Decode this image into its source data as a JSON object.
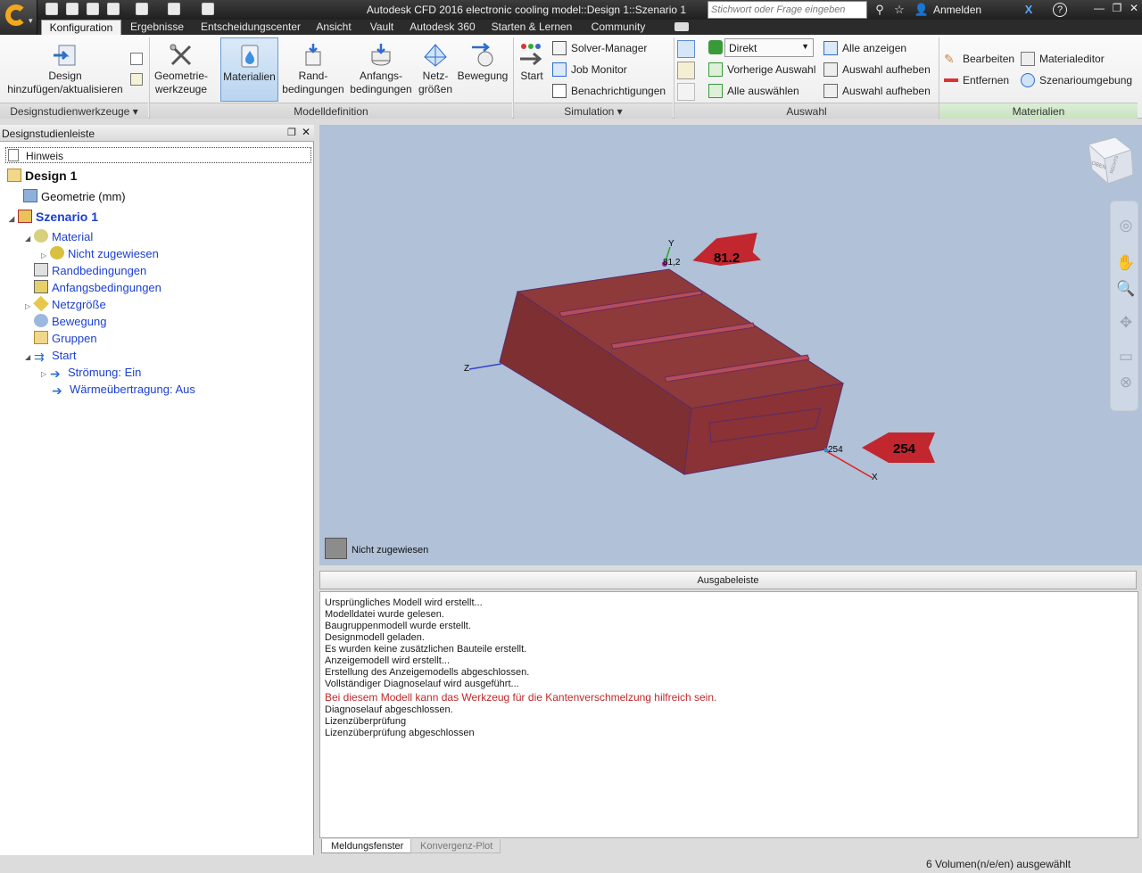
{
  "window": {
    "title": "Autodesk CFD 2016   electronic cooling model::Design 1::Szenario 1",
    "search_placeholder": "Stichwort oder Frage eingeben",
    "signin": "Anmelden",
    "help": "?"
  },
  "tabs": [
    "Konfiguration",
    "Ergebnisse",
    "Entscheidungscenter",
    "Ansicht",
    "Vault",
    "Autodesk 360",
    "Starten & Lernen",
    "Community"
  ],
  "ribbon": {
    "design_add": "Design\nhinzufügen/aktualisieren",
    "panel_designstudie": "Designstudienwerkzeuge",
    "geometry_tools": "Geometrie-\nwerkzeuge",
    "materials": "Materialien",
    "boundary": "Rand-\nbedingungen",
    "initial": "Anfangs-\nbedingungen",
    "mesh": "Netz-\ngrößen",
    "motion": "Bewegung",
    "panel_modell": "Modelldefinition",
    "start": "Start",
    "solver": "Solver-Manager",
    "job": "Job Monitor",
    "notify": "Benachrichtigungen",
    "panel_sim": "Simulation",
    "select_mode": "Direkt",
    "prev_sel": "Vorherige Auswahl",
    "select_all": "Alle auswählen",
    "show_all": "Alle anzeigen",
    "clear_sel1": "Auswahl aufheben",
    "clear_sel2": "Auswahl aufheben",
    "panel_auswahl": "Auswahl",
    "edit": "Bearbeiten",
    "remove": "Entfernen",
    "mat_editor": "Materialeditor",
    "scen_env": "Szenarioumgebung",
    "panel_mat": "Materialien"
  },
  "left": {
    "title": "Designstudienleiste",
    "hint": "Hinweis",
    "tree": {
      "design": "Design 1",
      "geometry": "Geometrie (mm)",
      "scenario": "Szenario 1",
      "material": "Material",
      "unassigned": "Nicht zugewiesen",
      "boundary": "Randbedingungen",
      "initial": "Anfangsbedingungen",
      "mesh": "Netzgröße",
      "motion": "Bewegung",
      "groups": "Gruppen",
      "start": "Start",
      "flow": "Strömung: Ein",
      "heat": "Wärmeübertragung: Aus"
    }
  },
  "viewport": {
    "label_top": "81.2",
    "label_right": "254",
    "tick_top": "81,2",
    "tick_right": "254",
    "axis_x": "X",
    "axis_y": "Y",
    "axis_z": "Z",
    "legend": "Nicht zugewiesen",
    "viewcube_face1": "OBEN",
    "viewcube_face2": "RECHTS"
  },
  "output": {
    "header": "Ausgabeleiste",
    "lines": [
      "Ursprüngliches Modell wird erstellt...",
      "Modelldatei wurde gelesen.",
      "Baugruppenmodell wurde erstellt.",
      "Designmodell geladen.",
      "Es wurden keine zusätzlichen Bauteile erstellt.",
      "Anzeigemodell wird erstellt...",
      "Erstellung des Anzeigemodells abgeschlossen.",
      "Vollständiger Diagnoselauf wird ausgeführt..."
    ],
    "warning": "Bei diesem Modell kann das Werkzeug für die Kantenverschmelzung hilfreich sein.",
    "lines2": [
      "Diagnoselauf abgeschlossen.",
      "Lizenzüberprüfung",
      "Lizenzüberprüfung abgeschlossen"
    ],
    "tab1": "Meldungsfenster",
    "tab2": "Konvergenz-Plot"
  },
  "status": "6 Volumen(n/e/en) ausgewählt"
}
